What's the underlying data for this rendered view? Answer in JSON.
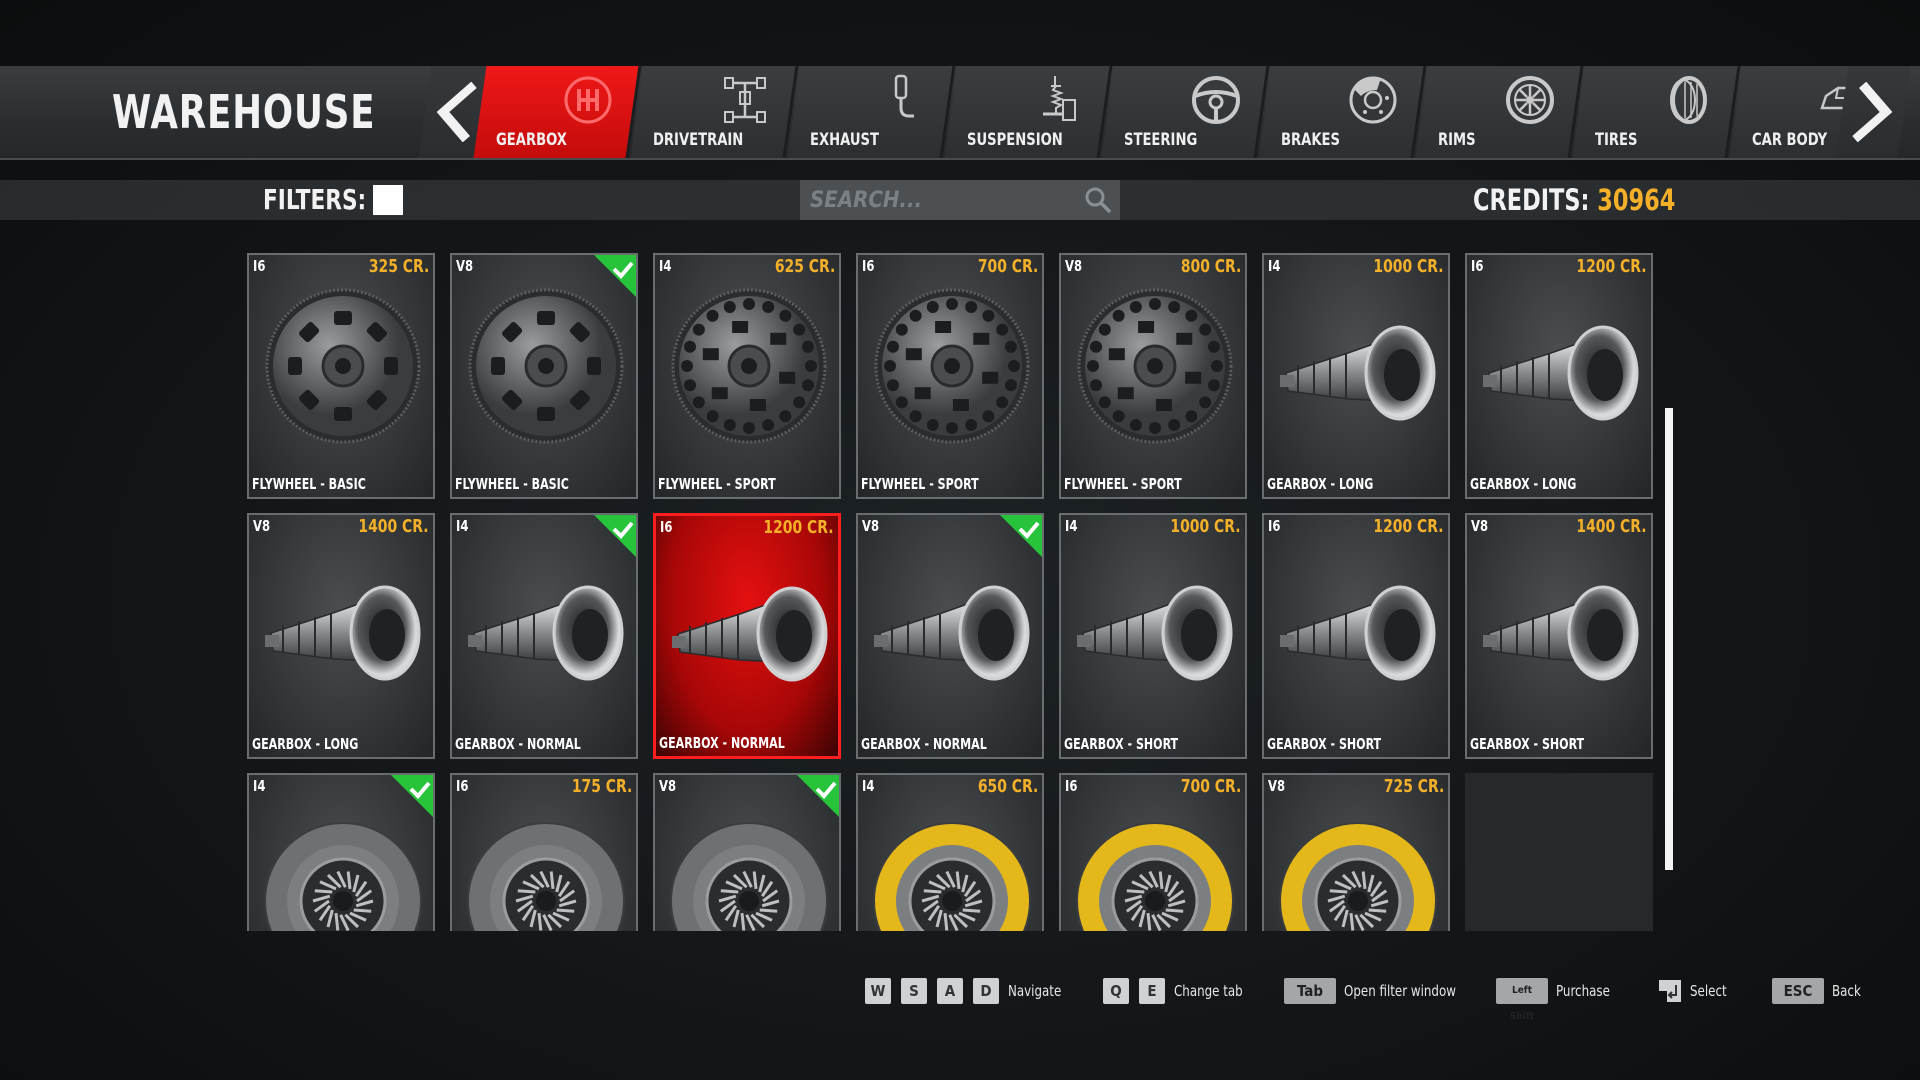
{
  "header": {
    "title": "WAREHOUSE"
  },
  "tabs": [
    {
      "label": "GEARBOX",
      "icon": "gear-shift-icon",
      "active": true
    },
    {
      "label": "DRIVETRAIN",
      "icon": "drivetrain-icon",
      "active": false
    },
    {
      "label": "EXHAUST",
      "icon": "exhaust-icon",
      "active": false
    },
    {
      "label": "SUSPENSION",
      "icon": "suspension-icon",
      "active": false
    },
    {
      "label": "STEERING",
      "icon": "steering-wheel-icon",
      "active": false
    },
    {
      "label": "BRAKES",
      "icon": "brake-disc-icon",
      "active": false
    },
    {
      "label": "RIMS",
      "icon": "rim-icon",
      "active": false
    },
    {
      "label": "TIRES",
      "icon": "tire-icon",
      "active": false
    },
    {
      "label": "CAR BODY",
      "icon": "car-body-icon",
      "active": false
    }
  ],
  "filterbar": {
    "filters_label": "FILTERS:",
    "search_placeholder": "SEARCH...",
    "credits_label": "CREDITS:",
    "credits_value": "30964"
  },
  "items": [
    {
      "engine": "I6",
      "price": "325 CR.",
      "name": "FLYWHEEL - BASIC",
      "kind": "flywheel",
      "owned": false
    },
    {
      "engine": "V8",
      "price": "",
      "name": "FLYWHEEL - BASIC",
      "kind": "flywheel",
      "owned": true
    },
    {
      "engine": "I4",
      "price": "625 CR.",
      "name": "FLYWHEEL - SPORT",
      "kind": "flywheel-sport",
      "owned": false
    },
    {
      "engine": "I6",
      "price": "700 CR.",
      "name": "FLYWHEEL - SPORT",
      "kind": "flywheel-sport",
      "owned": false
    },
    {
      "engine": "V8",
      "price": "800 CR.",
      "name": "FLYWHEEL - SPORT",
      "kind": "flywheel-sport",
      "owned": false
    },
    {
      "engine": "I4",
      "price": "1000 CR.",
      "name": "GEARBOX - LONG",
      "kind": "gearbox",
      "owned": false
    },
    {
      "engine": "I6",
      "price": "1200 CR.",
      "name": "GEARBOX - LONG",
      "kind": "gearbox",
      "owned": false
    },
    {
      "engine": "V8",
      "price": "1400 CR.",
      "name": "GEARBOX - LONG",
      "kind": "gearbox",
      "owned": false
    },
    {
      "engine": "I4",
      "price": "",
      "name": "GEARBOX - NORMAL",
      "kind": "gearbox",
      "owned": true
    },
    {
      "engine": "I6",
      "price": "1200 CR.",
      "name": "GEARBOX - NORMAL",
      "kind": "gearbox",
      "owned": false,
      "selected": true
    },
    {
      "engine": "V8",
      "price": "",
      "name": "GEARBOX - NORMAL",
      "kind": "gearbox",
      "owned": true
    },
    {
      "engine": "I4",
      "price": "1000 CR.",
      "name": "GEARBOX - SHORT",
      "kind": "gearbox",
      "owned": false
    },
    {
      "engine": "I6",
      "price": "1200 CR.",
      "name": "GEARBOX - SHORT",
      "kind": "gearbox",
      "owned": false
    },
    {
      "engine": "V8",
      "price": "1400 CR.",
      "name": "GEARBOX - SHORT",
      "kind": "gearbox",
      "owned": false
    },
    {
      "engine": "I4",
      "price": "",
      "name": "",
      "kind": "clutch",
      "owned": true
    },
    {
      "engine": "I6",
      "price": "175 CR.",
      "name": "",
      "kind": "clutch",
      "owned": false
    },
    {
      "engine": "V8",
      "price": "",
      "name": "",
      "kind": "clutch",
      "owned": true
    },
    {
      "engine": "I4",
      "price": "650 CR.",
      "name": "",
      "kind": "clutch-sport",
      "owned": false
    },
    {
      "engine": "I6",
      "price": "700 CR.",
      "name": "",
      "kind": "clutch-sport",
      "owned": false
    },
    {
      "engine": "V8",
      "price": "725 CR.",
      "name": "",
      "kind": "clutch-sport",
      "owned": false
    },
    {
      "engine": "",
      "price": "",
      "name": "",
      "kind": "empty",
      "owned": false
    }
  ],
  "hints": {
    "keys_nav": [
      "W",
      "S",
      "A",
      "D"
    ],
    "navigate": "Navigate",
    "keys_tab": [
      "Q",
      "E"
    ],
    "change_tab": "Change tab",
    "key_filter": "Tab",
    "open_filter": "Open filter window",
    "key_purchase": "Left Shift",
    "purchase": "Purchase",
    "select": "Select",
    "key_back": "ESC",
    "back": "Back"
  },
  "colors": {
    "accent": "#e81414",
    "price": "#f4b028",
    "owned_badge": "#27c33a"
  }
}
